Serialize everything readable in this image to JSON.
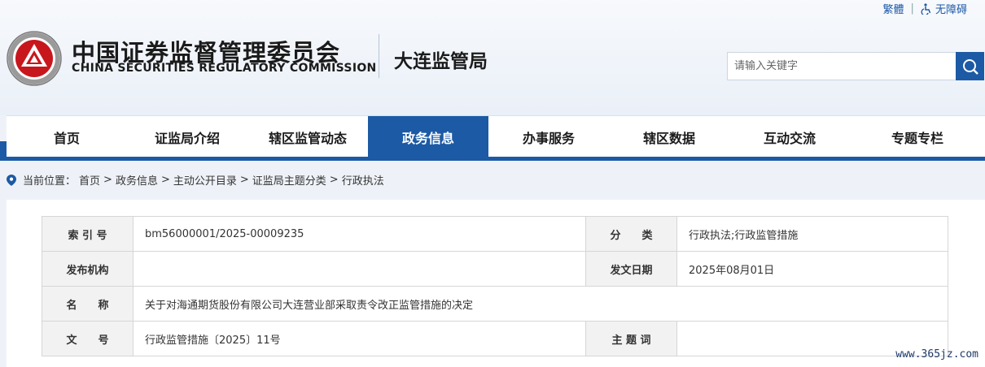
{
  "top_links": {
    "traditional": "繁體",
    "divider": "|",
    "accessibility": "无障碍"
  },
  "brand": {
    "cn": "中国证券监督管理委员会",
    "en": "CHINA SECURITIES REGULATORY COMMISSION",
    "bureau": "大连监管局"
  },
  "search": {
    "placeholder": "请输入关键字"
  },
  "nav": {
    "items": [
      "首页",
      "证监局介绍",
      "辖区监管动态",
      "政务信息",
      "办事服务",
      "辖区数据",
      "互动交流",
      "专题专栏"
    ],
    "active": "政务信息"
  },
  "breadcrumb": {
    "prefix": "当前位置：",
    "items": [
      "首页",
      "政务信息",
      "主动公开目录",
      "证监局主题分类",
      "行政执法"
    ],
    "sep": ">"
  },
  "meta": {
    "index_label": "索 引 号",
    "index_value": "bm56000001/2025-00009235",
    "category_label": "分　　类",
    "category_value": "行政执法;行政监管措施",
    "publisher_label": "发布机构",
    "publisher_value": "",
    "date_label": "发文日期",
    "date_value": "2025年08月01日",
    "name_label": "名　　称",
    "name_value": "关于对海通期货股份有限公司大连营业部采取责令改正监管措施的决定",
    "docno_label": "文　　号",
    "docno_value": "行政监管措施〔2025〕11号",
    "subject_label": "主 题 词",
    "subject_value": ""
  },
  "watermark": "www.365jz.com",
  "colors": {
    "primary": "#1c5aa5",
    "accent_red": "#c8161d"
  }
}
